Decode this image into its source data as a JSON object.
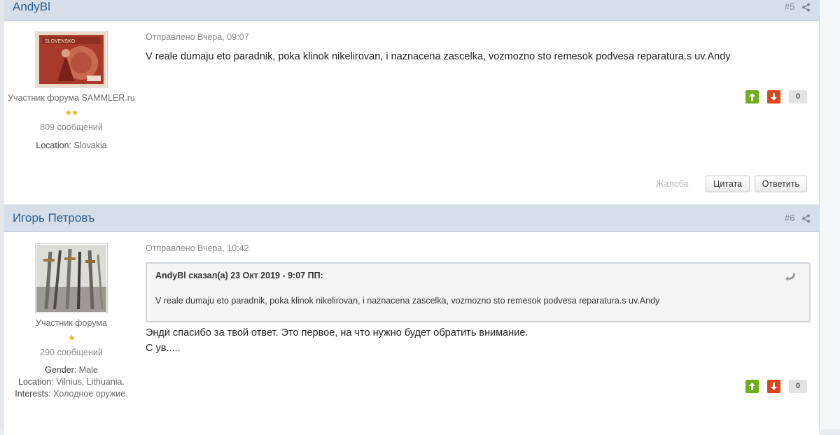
{
  "posts": [
    {
      "author": "AndyBl",
      "number": "#5",
      "profile": {
        "avatar": "slovensko-stamp-avatar",
        "title": "Участник форума SAMMLER.ru",
        "stars": "★★",
        "post_count": "809 сообщений",
        "location_label": "Location:",
        "location_value": "Slovakia"
      },
      "posted": "Отправлено Вчера, 09:07",
      "message": "V reale dumaju eto paradnik, poka klinok nikelirovan, i naznacena zascelka, vozmozno sto remesok podvesa reparatura.s uv.Andy",
      "votes": {
        "count": "0",
        "up_icon": "arrow-up-icon",
        "down_icon": "arrow-down-icon"
      },
      "actions": {
        "report": "Жалоба",
        "quote": "Цитата",
        "reply": "Ответить"
      }
    },
    {
      "author": "Игорь Петровъ",
      "number": "#6",
      "profile": {
        "avatar": "swords-avatar",
        "title": "Участник форума",
        "stars": "★",
        "post_count": "290 сообщений",
        "gender_label": "Gender:",
        "gender_value": "Male",
        "location_label": "Location:",
        "location_value": "Vilnius, Lithuania.",
        "interests_label": "Interests:",
        "interests_value": "Холодное оружие."
      },
      "posted": "Отправлено Вчера, 10:42",
      "quote": {
        "header": "AndyBl сказал(а) 23 Окт 2019 - 9:07 ПП:",
        "text": "V reale dumaju eto paradnik, poka klinok nikelirovan, i naznacena zascelka, vozmozno sto remesok podvesa reparatura.s uv.Andy"
      },
      "message_line1": "Энди спасибо за твой ответ. Это первое, на что нужно будет обратить внимание.",
      "message_line2": "С ув.....",
      "votes": {
        "count": "0"
      }
    }
  ],
  "colors": {
    "header_bg": "#d5dee9",
    "author_link": "#2f5d8c",
    "vote_up": "#6fae1e",
    "vote_down": "#d8461c",
    "star": "#e0b81a"
  }
}
